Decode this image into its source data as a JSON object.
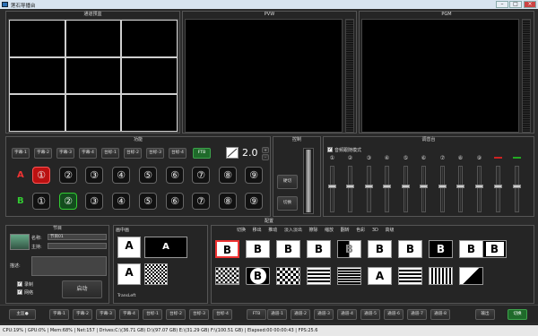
{
  "window": {
    "title": "莲石导播台",
    "min": "–",
    "max": "□",
    "close": "×"
  },
  "panels": {
    "multiview": "通道预监",
    "pvw": "PVW",
    "pgm": "PGM",
    "function": "功能",
    "control": "控制",
    "mixer": "调音台",
    "config": "配置",
    "program": "节目",
    "overlay": "画中画"
  },
  "function": {
    "top_buttons": [
      "字幕-1",
      "字幕-2",
      "字幕-3",
      "字幕-4",
      "台标-1",
      "台标-2",
      "台标-3",
      "台标-4",
      "FTB"
    ],
    "transition_value": "2.0",
    "rows": [
      {
        "label": "A",
        "numbers": [
          "①",
          "②",
          "③",
          "④",
          "⑤",
          "⑥",
          "⑦",
          "⑧",
          "⑨"
        ]
      },
      {
        "label": "B",
        "numbers": [
          "①",
          "②",
          "③",
          "④",
          "⑤",
          "⑥",
          "⑦",
          "⑧",
          "⑨"
        ]
      }
    ]
  },
  "control": {
    "take": "硬切",
    "cut": "切换"
  },
  "mixer": {
    "follow_label": "音频跟随模式",
    "channels": [
      "①",
      "②",
      "③",
      "④",
      "⑤",
      "⑥",
      "⑦",
      "⑧",
      "⑨",
      "",
      ""
    ],
    "meter_labels": [
      "L",
      "R"
    ]
  },
  "program": {
    "name_label": "名称:",
    "name_value": "节目01",
    "host_label": "主持:",
    "desc_label": "描述:",
    "record_label": "录制",
    "stream_label": "网络",
    "start_button": "启动"
  },
  "overlay": {
    "footer": "TransLeft"
  },
  "config": {
    "tabs": [
      "切换",
      "移出",
      "推动",
      "淡入淡出",
      "擦除",
      "缩放",
      "翻转",
      "色彩",
      "3D",
      "高级"
    ]
  },
  "bottom_bar": {
    "buttons": [
      "主监●",
      "字幕-1",
      "字幕-2",
      "字幕-3",
      "字幕-4",
      "台标-1",
      "台标-2",
      "台标-3",
      "台标-4",
      "FTB",
      "通道-1",
      "通道-2",
      "通道-3",
      "通道-4",
      "通道-5",
      "通道-6",
      "通道-7",
      "通道-8",
      "输出",
      "切换"
    ]
  },
  "status": {
    "text": "CPU:19% | GPU:0% | Mem:68% | Net:157 | Drives:C:\\(36.71 GB)  D:\\(97.07 GB)  E:\\(31.29 GB)  F:\\(100.51 GB) | Elapsed:00 00:00:43 | FPS:25.6"
  },
  "colors": {
    "accent_green": "#1f6a2a",
    "record_red": "#bb1111",
    "bg": "#2b2b2b"
  }
}
